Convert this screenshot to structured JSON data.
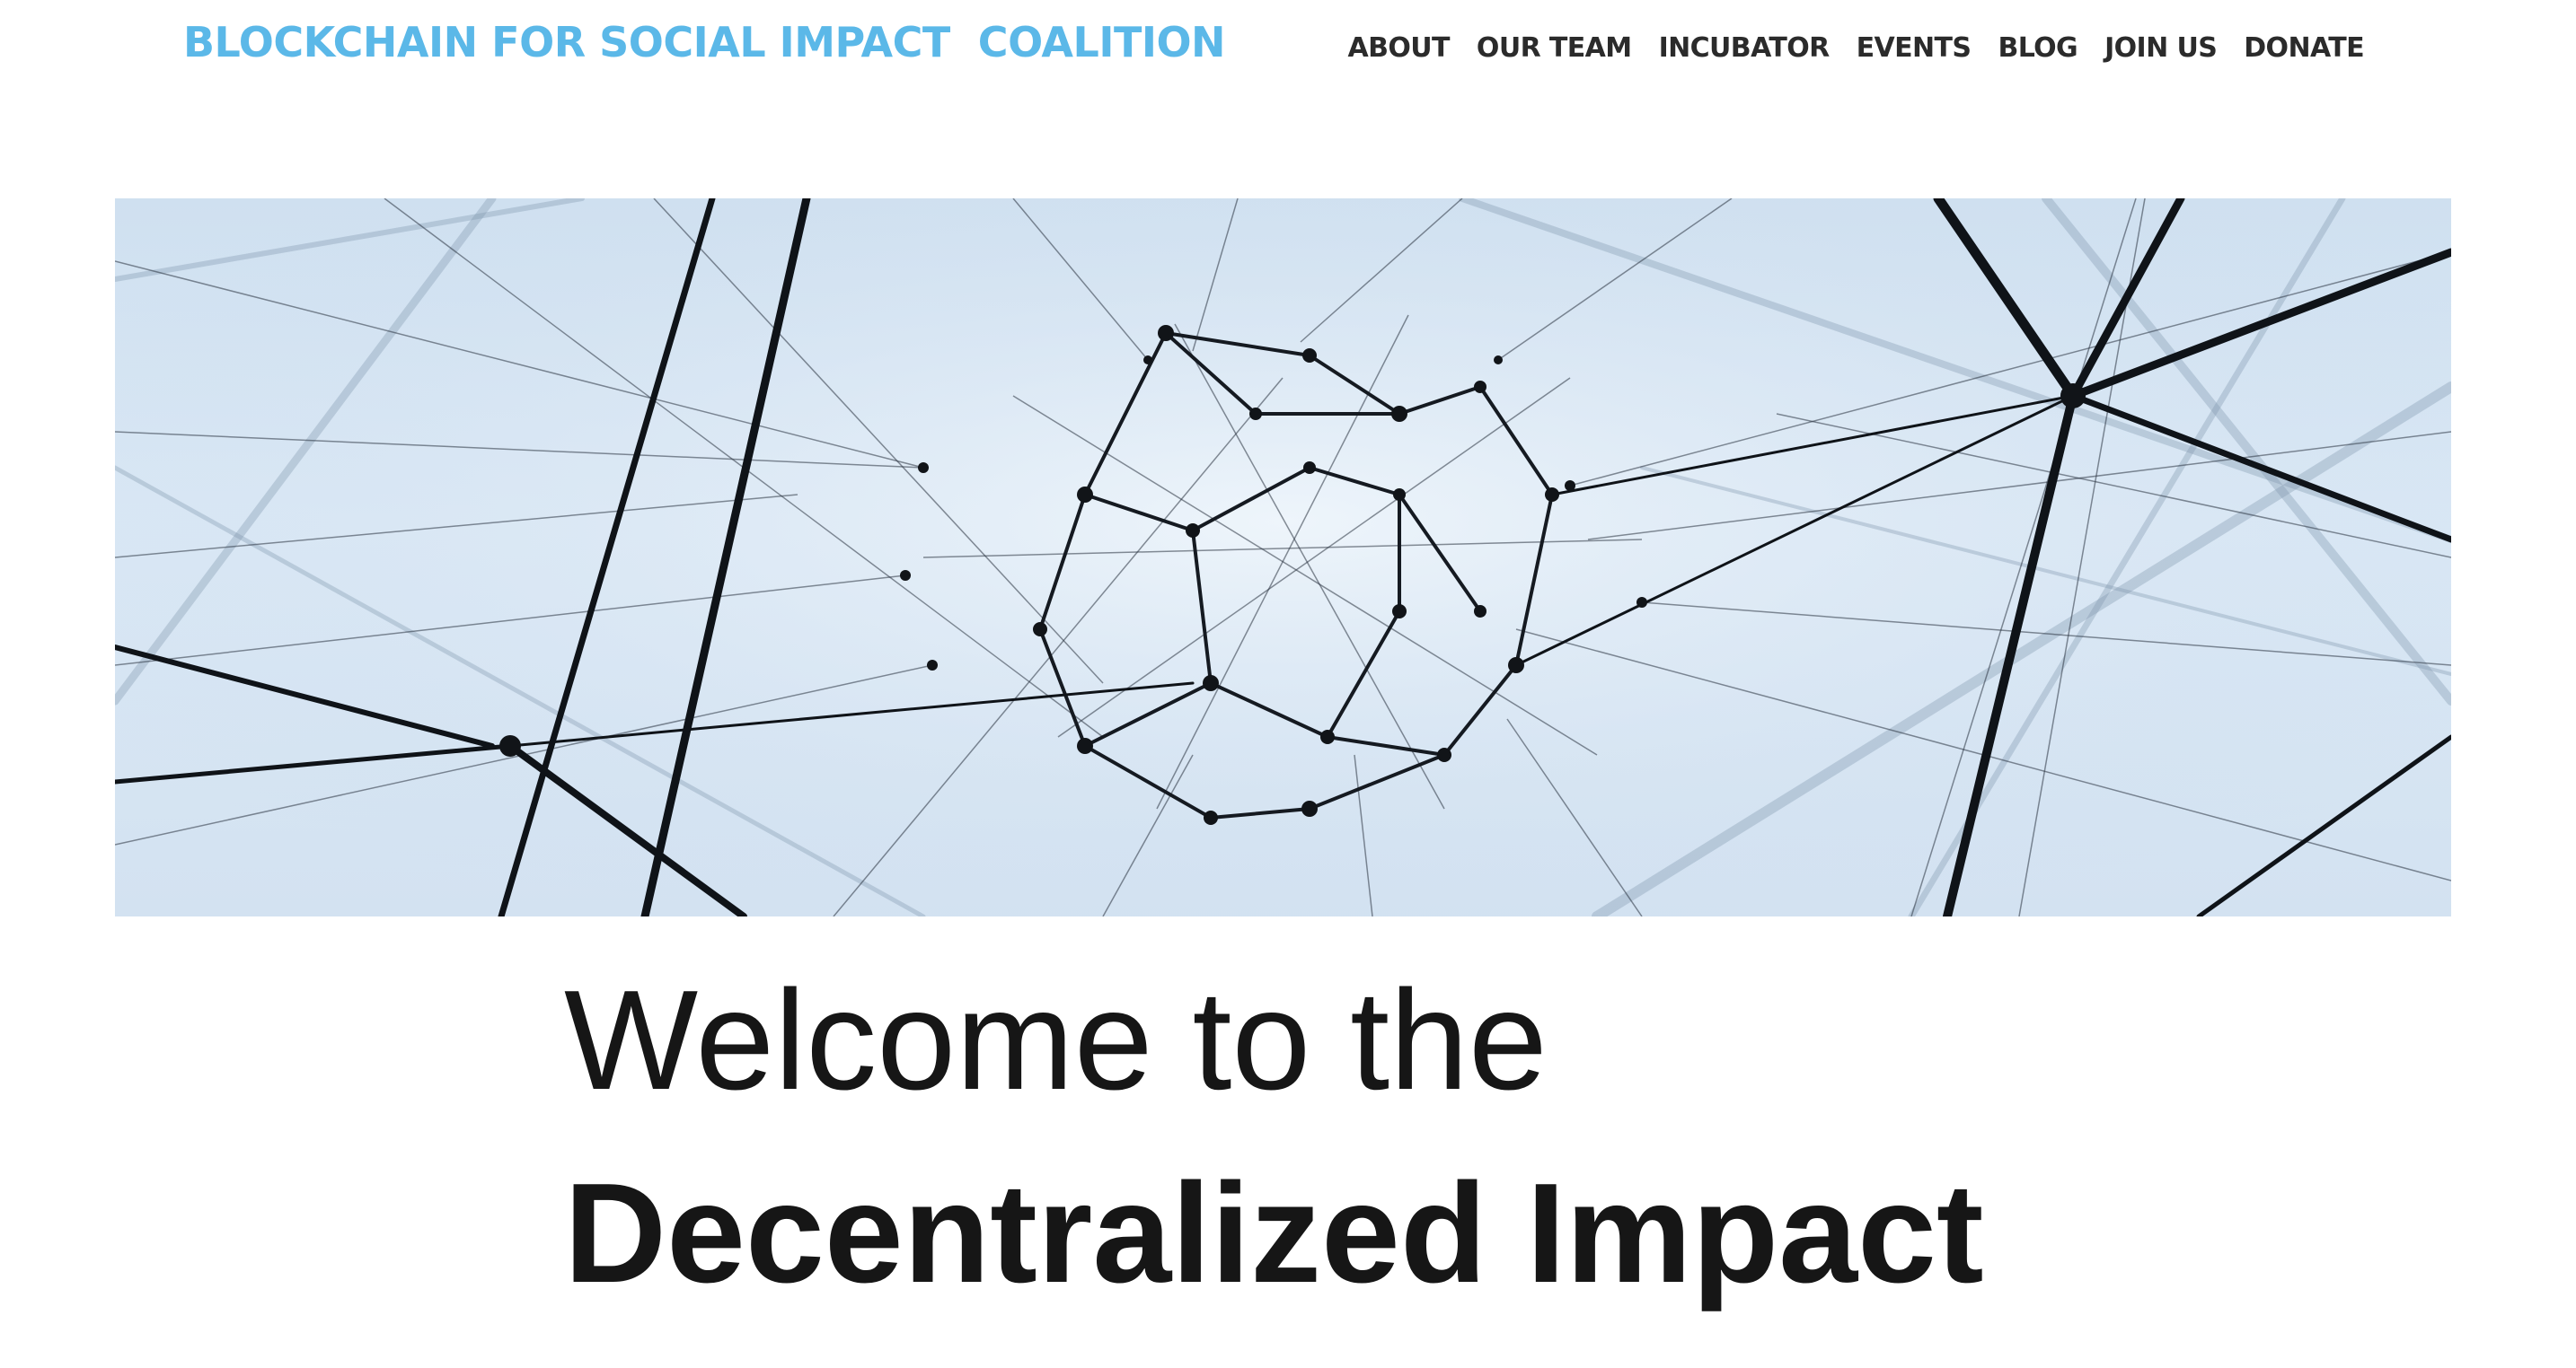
{
  "header": {
    "logo_text": "BLOCKCHAIN FOR SOCIAL IMPACT  COALITION",
    "nav": {
      "about": "ABOUT",
      "team": "OUR TEAM",
      "incubator": "INCUBATOR",
      "events": "EVENTS",
      "blog": "BLOG",
      "join": "JOIN US",
      "donate": "DONATE"
    }
  },
  "hero": {
    "image": "network-nodes-image"
  },
  "welcome": {
    "line1": "Welcome to the",
    "line2": "Decentralized Impact"
  },
  "colors": {
    "brand": "#5bb8e8",
    "nav_text": "#2b2b2b",
    "heading_text": "#161616",
    "hero_sky": "#d6e5f3",
    "hero_lines": "#1a1f26"
  }
}
